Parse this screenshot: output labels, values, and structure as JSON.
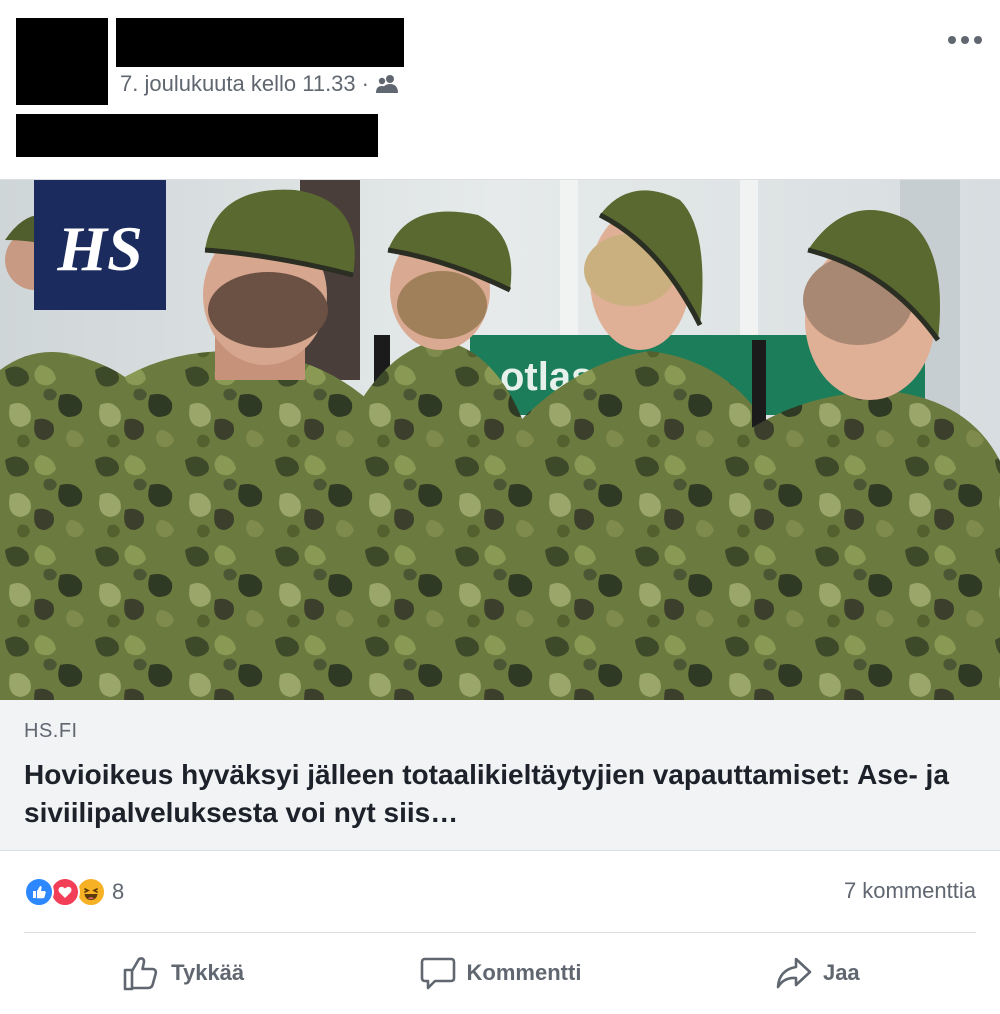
{
  "post": {
    "timestamp": "7. joulukuuta kello 11.33",
    "separator": "·",
    "audience_icon": "friends-icon",
    "more_icon": "more-options-icon"
  },
  "link_preview": {
    "logo_text": "HS",
    "domain": "HS.FI",
    "title": "Hovioikeus hyväksyi jälleen totaalikieltäytyjien vapauttamiset: Ase- ja siviilipalveluksesta voi nyt siis…"
  },
  "reactions": {
    "icons": [
      "like-reaction-icon",
      "love-reaction-icon",
      "haha-reaction-icon"
    ],
    "count": "8",
    "comments": "7 kommenttia"
  },
  "actions": {
    "like": "Tykkää",
    "comment": "Kommentti",
    "share": "Jaa"
  },
  "colors": {
    "like_blue": "#2d88ff",
    "love_red": "#f33e58",
    "haha_yellow": "#f7b125",
    "hs_navy": "#1b2b5e",
    "meta_gray": "#606770"
  }
}
